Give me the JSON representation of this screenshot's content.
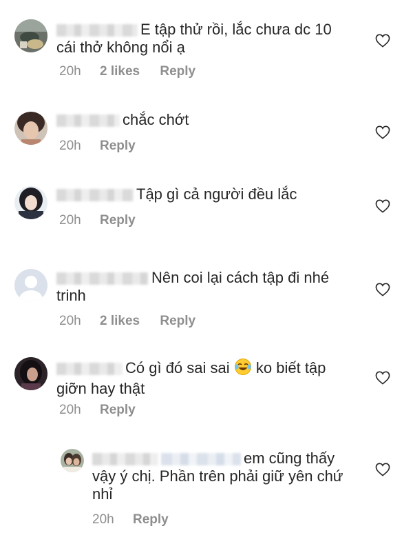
{
  "comments": [
    {
      "text": "E tập thử rồi, lắc chưa dc 10 cái thở không nổi ạ",
      "time": "20h",
      "likes": "2 likes",
      "reply": "Reply"
    },
    {
      "text": "chắc chớt",
      "time": "20h",
      "reply": "Reply"
    },
    {
      "text": "Tập gì cả người đều lắc",
      "time": "20h",
      "reply": "Reply"
    },
    {
      "text": "Nên coi lại cách tập đi nhé trinh",
      "time": "20h",
      "likes": "2 likes",
      "reply": "Reply"
    },
    {
      "text_before": "Có gì đó sai sai",
      "text_after": "ko biết tập giỡn hay thật",
      "emoji": "face-with-tears-of-joy",
      "time": "20h",
      "reply": "Reply"
    },
    {
      "text": "em cũng thấy vậy ý chị. Phần trên phải giữ yên chứ nhỉ",
      "time": "20h",
      "reply": "Reply"
    }
  ],
  "icons": {
    "like": "heart-outline-icon",
    "default_avatar": "default-user-avatar"
  },
  "colors": {
    "text": "#262626",
    "meta": "#8e8e8e",
    "default_avatar_bg": "#dbe1ea"
  }
}
